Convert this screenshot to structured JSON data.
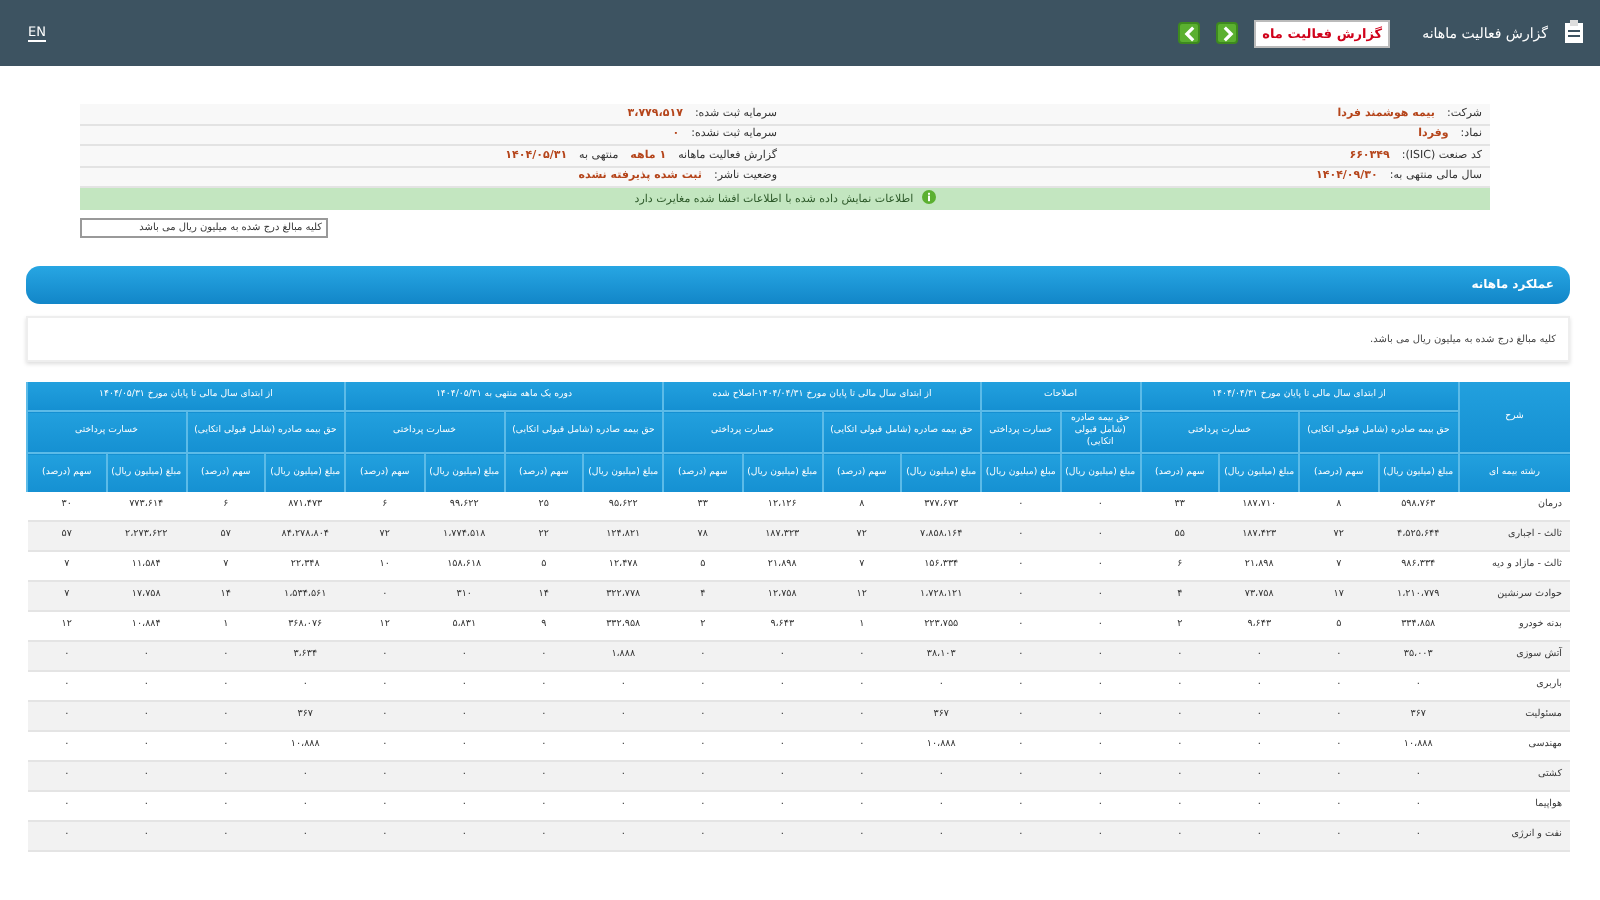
{
  "top_bar": {
    "title": "گزارش فعالیت ماهانه",
    "report_badge": "گزارش فعالیت ماه",
    "language": "EN"
  },
  "info": {
    "rows": [
      {
        "right": [
          {
            "kind": "label",
            "text": "شرکت:"
          },
          {
            "kind": "value",
            "text": "بیمه هوشمند فردا"
          }
        ],
        "left": [
          {
            "kind": "label",
            "text": "سرمایه ثبت شده:"
          },
          {
            "kind": "value",
            "text": "۳،۷۷۹،۵۱۷"
          }
        ]
      },
      {
        "right": [
          {
            "kind": "label",
            "text": "نماد:"
          },
          {
            "kind": "value",
            "text": "وفردا"
          }
        ],
        "left": [
          {
            "kind": "label",
            "text": "سرمایه ثبت نشده:"
          },
          {
            "kind": "value",
            "text": "۰"
          }
        ]
      },
      {
        "right": [
          {
            "kind": "label",
            "text": "کد صنعت (ISIC):"
          },
          {
            "kind": "value",
            "text": "۶۶۰۳۴۹"
          }
        ],
        "left": [
          {
            "kind": "label",
            "text": "گزارش فعالیت ماهانه"
          },
          {
            "kind": "value",
            "text": "۱ ماهه"
          },
          {
            "kind": "label",
            "text": "منتهی به"
          },
          {
            "kind": "value",
            "text": "۱۴۰۴/۰۵/۳۱"
          }
        ]
      },
      {
        "right": [
          {
            "kind": "label",
            "text": "سال مالی منتهی به:"
          },
          {
            "kind": "value",
            "text": "۱۴۰۴/۰۹/۳۰"
          }
        ],
        "left": [
          {
            "kind": "label",
            "text": "وضعیت ناشر:"
          },
          {
            "kind": "value",
            "text": "ثبت شده پذیرفته نشده"
          }
        ]
      }
    ]
  },
  "alert": "اطلاعات نمایش داده شده با اطلاعات افشا شده مغایرت دارد",
  "unit_select": {
    "value": "کلیه مبالغ درج شده به میلیون ریال می باشد"
  },
  "section": {
    "title": "عملکرد ماهانه",
    "note": "کلیه مبالغ درج شده به میلیون ریال می باشد."
  },
  "table": {
    "corner": "شرح",
    "row_header": "رشته بیمه ای",
    "groups": [
      {
        "title": "از ابتدای سال مالی تا پایان مورخ ۱۴۰۴/۰۴/۳۱",
        "subgroups": [
          {
            "title": "حق بیمه صادره (شامل قبولی اتکایی)",
            "columns": [
              "مبلغ (میلیون ریال)",
              "سهم (درصد)"
            ]
          },
          {
            "title": "خسارت پرداختی",
            "columns": [
              "مبلغ (میلیون ریال)",
              "سهم (درصد)"
            ]
          }
        ]
      },
      {
        "title": "اصلاحات",
        "subgroups": [
          {
            "title": "حق بیمه صادره (شامل قبولی اتکایی)",
            "columns": [
              "مبلغ (میلیون ریال)"
            ]
          },
          {
            "title": "خسارت پرداختی",
            "columns": [
              "مبلغ (میلیون ریال)"
            ]
          }
        ]
      },
      {
        "title": "از ابتدای سال مالی تا پایان مورخ ۱۴۰۴/۰۴/۳۱-اصلاح شده",
        "subgroups": [
          {
            "title": "حق بیمه صادره (شامل قبولی اتکایی)",
            "columns": [
              "مبلغ (میلیون ریال)",
              "سهم (درصد)"
            ]
          },
          {
            "title": "خسارت پرداختی",
            "columns": [
              "مبلغ (میلیون ریال)",
              "سهم (درصد)"
            ]
          }
        ]
      },
      {
        "title": "دوره یک ماهه منتهی به ۱۴۰۴/۰۵/۳۱",
        "subgroups": [
          {
            "title": "حق بیمه صادره (شامل قبولی اتکایی)",
            "columns": [
              "مبلغ (میلیون ریال)",
              "سهم (درصد)"
            ]
          },
          {
            "title": "خسارت پرداختی",
            "columns": [
              "مبلغ (میلیون ریال)",
              "سهم (درصد)"
            ]
          }
        ]
      },
      {
        "title": "از ابتدای سال مالی تا پایان مورخ ۱۴۰۴/۰۵/۳۱",
        "subgroups": [
          {
            "title": "حق بیمه صادره (شامل قبولی اتکایی)",
            "columns": [
              "مبلغ (میلیون ریال)",
              "سهم (درصد)"
            ]
          },
          {
            "title": "خسارت پرداختی",
            "columns": [
              "مبلغ (میلیون ریال)",
              "سهم (درصد)"
            ]
          }
        ]
      }
    ],
    "rows": [
      {
        "label": "درمان",
        "cells": [
          "۵۹۸،۷۶۳",
          "۸",
          "۱۸۷،۷۱۰",
          "۳۳",
          "۰",
          "۰",
          "۳۷۷،۶۷۳",
          "۸",
          "۱۲،۱۲۶",
          "۳۳",
          "۹۵،۶۲۲",
          "۲۵",
          "۹۹،۶۲۲",
          "۶",
          "۸۷۱،۴۷۳",
          "۶",
          "۷۷۳،۶۱۴",
          "۳۰"
        ]
      },
      {
        "label": "ثالث - اجباری",
        "cells": [
          "۴،۵۲۵،۶۴۴",
          "۷۲",
          "۱۸۷،۴۲۳",
          "۵۵",
          "۰",
          "۰",
          "۷،۸۵۸،۱۶۴",
          "۷۲",
          "۱۸۷،۳۲۳",
          "۷۸",
          "۱۲۴،۸۲۱",
          "۲۲",
          "۱،۷۷۴،۵۱۸",
          "۷۲",
          "۸۴،۲۷۸،۸۰۴",
          "۵۷",
          "۲،۲۷۳،۶۲۲",
          "۵۷"
        ]
      },
      {
        "label": "ثالث - مازاد و دیه",
        "cells": [
          "۹۸۶،۳۳۴",
          "۷",
          "۲۱،۸۹۸",
          "۶",
          "۰",
          "۰",
          "۱۵۶،۳۳۴",
          "۷",
          "۲۱،۸۹۸",
          "۵",
          "۱۲،۴۷۸",
          "۵",
          "۱۵۸،۶۱۸",
          "۱۰",
          "۲۲،۳۴۸",
          "۷",
          "۱۱،۵۸۴",
          "۷"
        ]
      },
      {
        "label": "حوادث سرنشین",
        "cells": [
          "۱،۲۱۰،۷۷۹",
          "۱۷",
          "۷۳،۷۵۸",
          "۴",
          "۰",
          "۰",
          "۱،۷۲۸،۱۲۱",
          "۱۲",
          "۱۲،۷۵۸",
          "۴",
          "۳۲۲،۷۷۸",
          "۱۴",
          "۳۱۰",
          "۰",
          "۱،۵۳۴،۵۶۱",
          "۱۴",
          "۱۷،۷۵۸",
          "۷"
        ]
      },
      {
        "label": "بدنه خودرو",
        "cells": [
          "۳۳۴،۸۵۸",
          "۵",
          "۹،۶۴۳",
          "۲",
          "۰",
          "۰",
          "۲۲۳،۷۵۵",
          "۱",
          "۹،۶۴۳",
          "۲",
          "۳۳۲،۹۵۸",
          "۹",
          "۵،۸۳۱",
          "۱۲",
          "۳۶۸،۰۷۶",
          "۱",
          "۱۰،۸۸۴",
          "۱۲"
        ]
      },
      {
        "label": "آتش سوزی",
        "cells": [
          "۳۵،۰۰۳",
          "۰",
          "۰",
          "۰",
          "۰",
          "۰",
          "۳۸،۱۰۳",
          "۰",
          "۰",
          "۰",
          "۱،۸۸۸",
          "۰",
          "۰",
          "۰",
          "۳،۶۳۴",
          "۰",
          "۰",
          "۰"
        ]
      },
      {
        "label": "باربری",
        "cells": [
          "۰",
          "۰",
          "۰",
          "۰",
          "۰",
          "۰",
          "۰",
          "۰",
          "۰",
          "۰",
          "۰",
          "۰",
          "۰",
          "۰",
          "۰",
          "۰",
          "۰",
          "۰"
        ]
      },
      {
        "label": "مسئولیت",
        "cells": [
          "۳۶۷",
          "۰",
          "۰",
          "۰",
          "۰",
          "۰",
          "۳۶۷",
          "۰",
          "۰",
          "۰",
          "۰",
          "۰",
          "۰",
          "۰",
          "۳۶۷",
          "۰",
          "۰",
          "۰"
        ]
      },
      {
        "label": "مهندسی",
        "cells": [
          "۱۰،۸۸۸",
          "۰",
          "۰",
          "۰",
          "۰",
          "۰",
          "۱۰،۸۸۸",
          "۰",
          "۰",
          "۰",
          "۰",
          "۰",
          "۰",
          "۰",
          "۱۰،۸۸۸",
          "۰",
          "۰",
          "۰"
        ]
      },
      {
        "label": "کشتی",
        "cells": [
          "۰",
          "۰",
          "۰",
          "۰",
          "۰",
          "۰",
          "۰",
          "۰",
          "۰",
          "۰",
          "۰",
          "۰",
          "۰",
          "۰",
          "۰",
          "۰",
          "۰",
          "۰"
        ]
      },
      {
        "label": "هواپیما",
        "cells": [
          "۰",
          "۰",
          "۰",
          "۰",
          "۰",
          "۰",
          "۰",
          "۰",
          "۰",
          "۰",
          "۰",
          "۰",
          "۰",
          "۰",
          "۰",
          "۰",
          "۰",
          "۰"
        ]
      },
      {
        "label": "نفت و انرژی",
        "cells": [
          "۰",
          "۰",
          "۰",
          "۰",
          "۰",
          "۰",
          "۰",
          "۰",
          "۰",
          "۰",
          "۰",
          "۰",
          "۰",
          "۰",
          "۰",
          "۰",
          "۰",
          "۰"
        ]
      }
    ]
  }
}
